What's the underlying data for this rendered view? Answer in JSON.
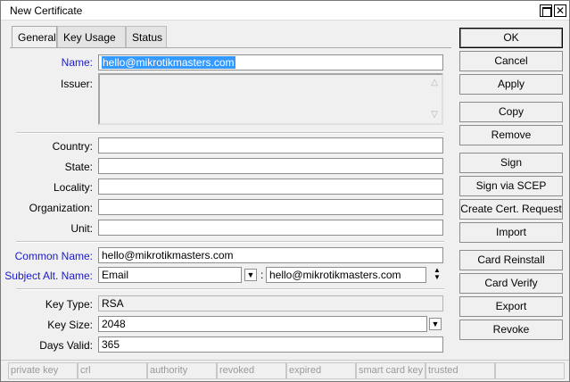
{
  "window": {
    "title": "New Certificate",
    "maximize_icon": "maximize-icon",
    "close_glyph": "✕"
  },
  "tabs": [
    {
      "label": "General",
      "active": true
    },
    {
      "label": "Key Usage",
      "active": false
    },
    {
      "label": "Status",
      "active": false
    }
  ],
  "form": {
    "name": {
      "label": "Name:",
      "value": "hello@mikrotikmasters.com"
    },
    "issuer": {
      "label": "Issuer:",
      "value": ""
    },
    "country": {
      "label": "Country:",
      "value": ""
    },
    "state": {
      "label": "State:",
      "value": ""
    },
    "locality": {
      "label": "Locality:",
      "value": ""
    },
    "organization": {
      "label": "Organization:",
      "value": ""
    },
    "unit": {
      "label": "Unit:",
      "value": ""
    },
    "common_name": {
      "label": "Common Name:",
      "value": "hello@mikrotikmasters.com"
    },
    "subject_alt_name": {
      "label": "Subject Alt. Name:",
      "type_value": "Email",
      "separator": ":",
      "value": "hello@mikrotikmasters.com"
    },
    "key_type": {
      "label": "Key Type:",
      "value": "RSA"
    },
    "key_size": {
      "label": "Key Size:",
      "value": "2048"
    },
    "days_valid": {
      "label": "Days Valid:",
      "value": "365"
    }
  },
  "buttons": {
    "ok": "OK",
    "cancel": "Cancel",
    "apply": "Apply",
    "copy": "Copy",
    "remove": "Remove",
    "sign": "Sign",
    "sign_via_scep": "Sign via SCEP",
    "create_cert_request": "Create Cert. Request",
    "import": "Import",
    "card_reinstall": "Card Reinstall",
    "card_verify": "Card Verify",
    "export": "Export",
    "revoke": "Revoke"
  },
  "status_flags": [
    "private key",
    "crl",
    "authority",
    "revoked",
    "expired",
    "smart card key",
    "trusted",
    ""
  ],
  "colors": {
    "accent_label": "#1a1acc",
    "selection": "#3399ff",
    "window_bg": "#f0f0f0"
  }
}
